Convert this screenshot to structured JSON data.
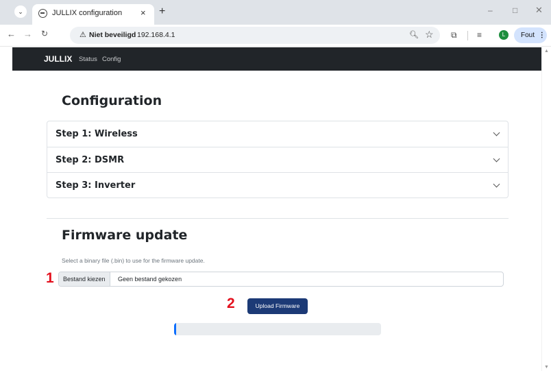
{
  "browser": {
    "tab_title": "JULLIX configuration",
    "tab_close": "×",
    "new_tab": "+",
    "menu_chevron": "⌄",
    "security_label": "Niet beveiligd",
    "url": "192.168.4.1",
    "profile_initial": "L",
    "error_button": "Fout",
    "window_controls": {
      "minimize": "–",
      "maximize": "□",
      "close": "✕"
    }
  },
  "site_nav": {
    "brand": "JULLIX",
    "links": [
      "Status",
      "Config"
    ]
  },
  "configuration": {
    "heading": "Configuration",
    "steps": [
      "Step 1: Wireless",
      "Step 2: DSMR",
      "Step 3: Inverter"
    ]
  },
  "firmware": {
    "heading": "Firmware update",
    "help": "Select a binary file (.bin) to use for the firmware update.",
    "file_button": "Bestand kiezen",
    "file_name": "Geen bestand gekozen",
    "upload_button": "Upload Firmware",
    "progress": 0.01
  },
  "annotations": [
    "1",
    "2"
  ],
  "colors": {
    "navbar": "#212529",
    "upload_button": "#1c3a76",
    "progress_fill": "#0d6efd",
    "marker": "#e3101d"
  }
}
